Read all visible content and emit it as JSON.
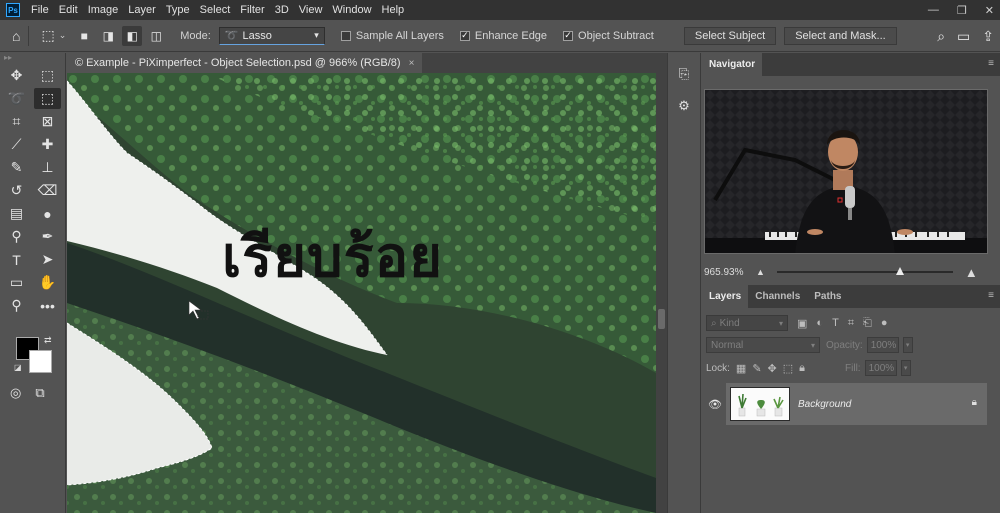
{
  "app": {
    "logo": "Ps"
  },
  "menu": [
    "File",
    "Edit",
    "Image",
    "Layer",
    "Type",
    "Select",
    "Filter",
    "3D",
    "View",
    "Window",
    "Help"
  ],
  "window_controls": {
    "minimize": "—",
    "restore": "❐",
    "close": "✕"
  },
  "options_bar": {
    "mode_label": "Mode:",
    "mode_value": "Lasso",
    "sample_all_layers": {
      "label": "Sample All Layers",
      "checked": false
    },
    "enhance_edge": {
      "label": "Enhance Edge",
      "checked": true
    },
    "object_subtract": {
      "label": "Object Subtract",
      "checked": true
    },
    "select_subject": "Select Subject",
    "select_and_mask": "Select and Mask..."
  },
  "document": {
    "tab_title": "© Example - PiXimperfect - Object Selection.psd @ 966% (RGB/8)",
    "tab_close": "×",
    "overlay_caption": "เรียบร้อย"
  },
  "navigator": {
    "title": "Navigator",
    "zoom_value": "965.93%",
    "zoom_slider_level": 0.7
  },
  "layers_panel": {
    "tabs": [
      "Layers",
      "Channels",
      "Paths"
    ],
    "kind_label": "Kind",
    "blend_mode": "Normal",
    "opacity_label": "Opacity:",
    "opacity_value": "100%",
    "lock_label": "Lock:",
    "fill_label": "Fill:",
    "fill_value": "100%",
    "layers": [
      {
        "name": "Background",
        "visible": true,
        "locked": true
      }
    ]
  },
  "colors": {
    "foreground": "#000000",
    "background": "#ffffff",
    "accent": "#31a8ff"
  }
}
